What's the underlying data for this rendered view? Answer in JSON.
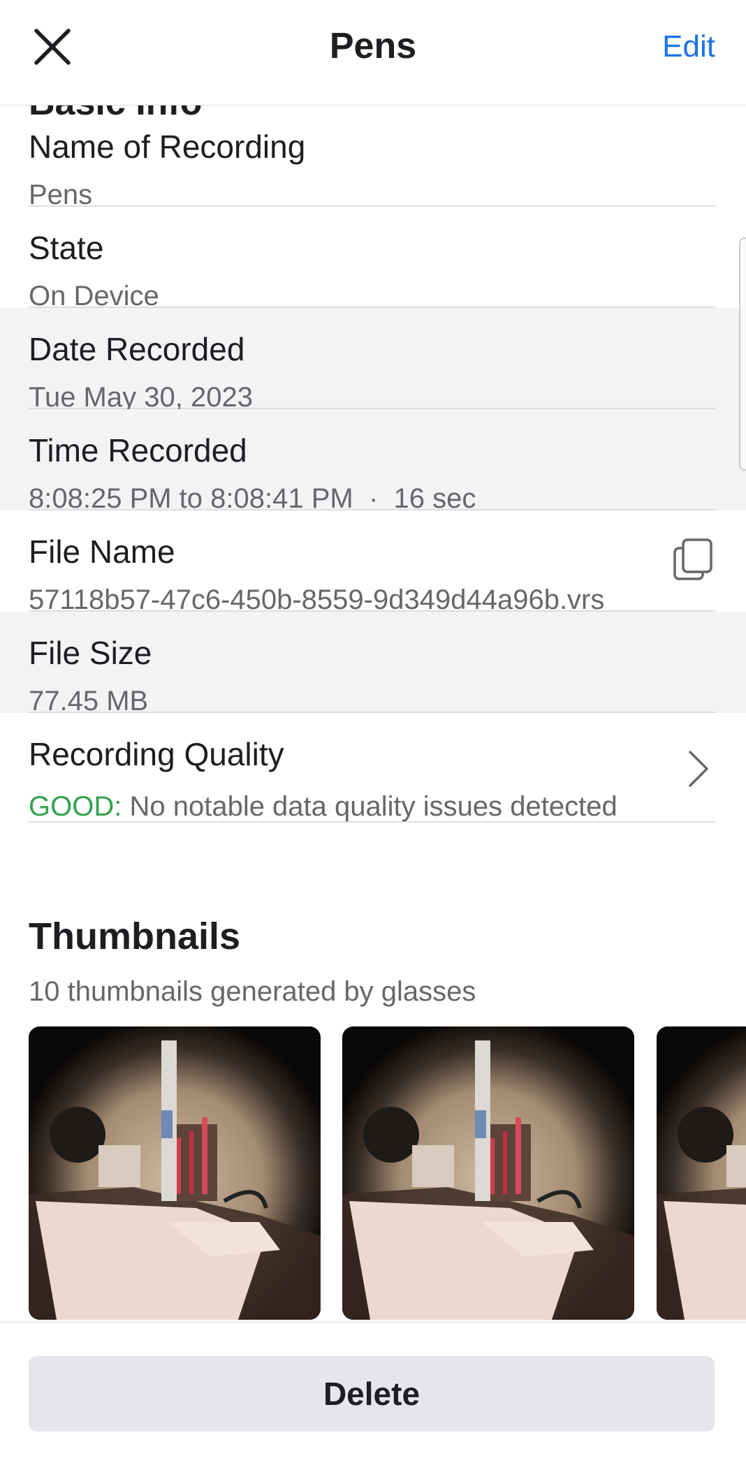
{
  "header": {
    "title": "Pens",
    "edit_label": "Edit",
    "close_icon": "close-icon"
  },
  "section": {
    "title_peek": "Basic Info"
  },
  "details": {
    "name": {
      "label": "Name of Recording",
      "value": "Pens"
    },
    "state": {
      "label": "State",
      "value": "On Device"
    },
    "date": {
      "label": "Date Recorded",
      "value": "Tue May 30, 2023"
    },
    "time": {
      "label": "Time Recorded",
      "value": "8:08:25 PM to 8:08:41 PM  ·  16 sec"
    },
    "file_name": {
      "label": "File Name",
      "value": "57118b57-47c6-450b-8559-9d349d44a96b.vrs",
      "icon": "copy-icon"
    },
    "file_size": {
      "label": "File Size",
      "value": "77.45 MB"
    },
    "quality": {
      "label": "Recording Quality",
      "status": "GOOD:",
      "description": "No notable data quality issues detected",
      "icon": "chevron-right-icon"
    }
  },
  "thumbnails": {
    "title": "Thumbnails",
    "subtitle": "10 thumbnails generated by glasses"
  },
  "footer": {
    "delete_label": "Delete"
  },
  "colors": {
    "accent": "#1b74e4",
    "good": "#31a24c",
    "shaded_row": "#f2f3f5",
    "button_bg": "#e4e6eb"
  }
}
